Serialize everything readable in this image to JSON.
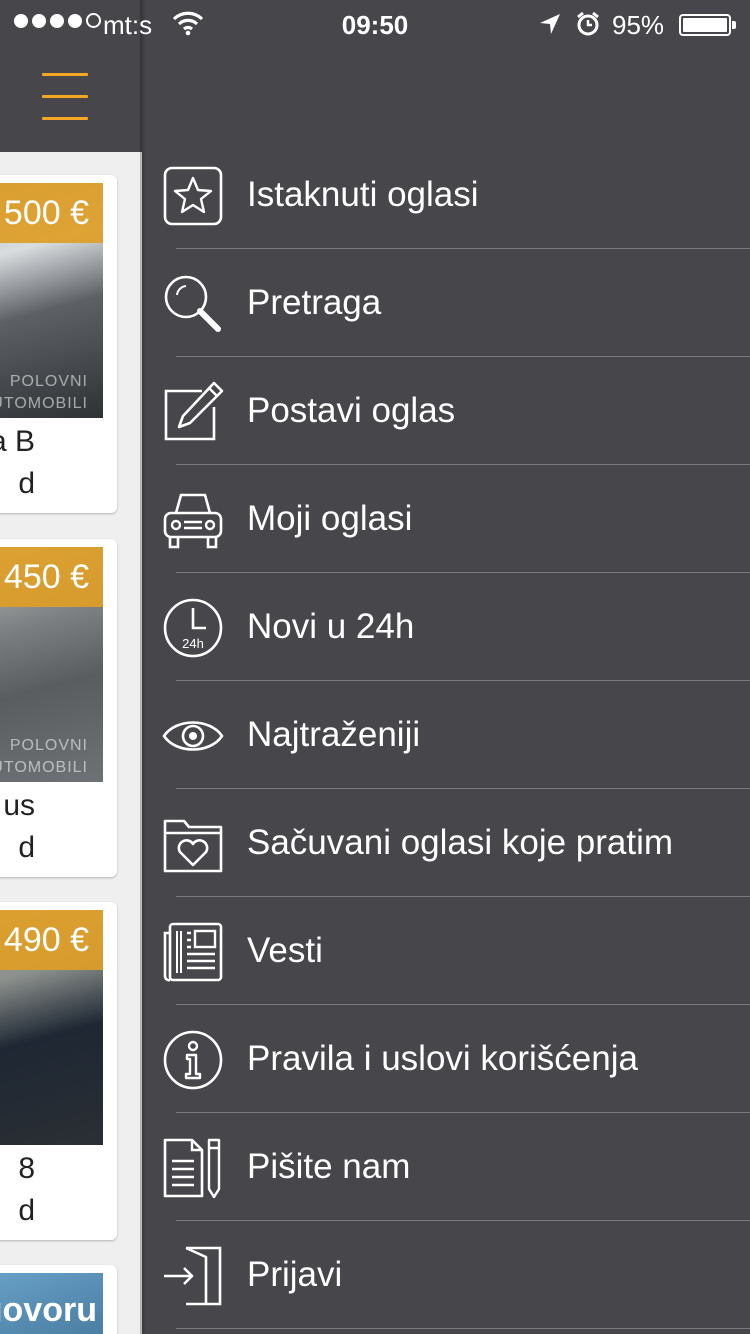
{
  "status_bar": {
    "carrier": "mt:s",
    "time": "09:50",
    "battery_percent": "95%"
  },
  "listing_panel": {
    "cards": [
      {
        "price": "500 €",
        "title_fragment": "a B",
        "subtitle_fragment": "d",
        "watermark_top": "POLOVNI",
        "watermark_bottom": "AUTOMOBILI"
      },
      {
        "price": "450 €",
        "title_fragment": "us",
        "subtitle_fragment": "d",
        "watermark_top": "POLOVNI",
        "watermark_bottom": "AUTOMOBILI"
      },
      {
        "price": "490 €",
        "title_fragment": "8",
        "subtitle_fragment": "d"
      },
      {
        "banner": "govoru"
      }
    ]
  },
  "menu": {
    "items": [
      {
        "label": "Istaknuti oglasi",
        "icon": "star-icon"
      },
      {
        "label": "Pretraga",
        "icon": "search-icon"
      },
      {
        "label": "Postavi oglas",
        "icon": "edit-icon"
      },
      {
        "label": "Moji oglasi",
        "icon": "car-icon"
      },
      {
        "label": "Novi u 24h",
        "icon": "clock-24h-icon",
        "icon_text": "24h"
      },
      {
        "label": "Najtraženiji",
        "icon": "eye-icon"
      },
      {
        "label": "Sačuvani oglasi koje pratim",
        "icon": "folder-heart-icon"
      },
      {
        "label": "Vesti",
        "icon": "newspaper-icon"
      },
      {
        "label": "Pravila i uslovi korišćenja",
        "icon": "info-icon"
      },
      {
        "label": "Pišite nam",
        "icon": "write-document-icon"
      },
      {
        "label": "Prijavi",
        "icon": "login-icon"
      }
    ]
  },
  "colors": {
    "menu_background": "#47474b",
    "accent": "#f5a623",
    "price_badge": "#de9d26"
  }
}
